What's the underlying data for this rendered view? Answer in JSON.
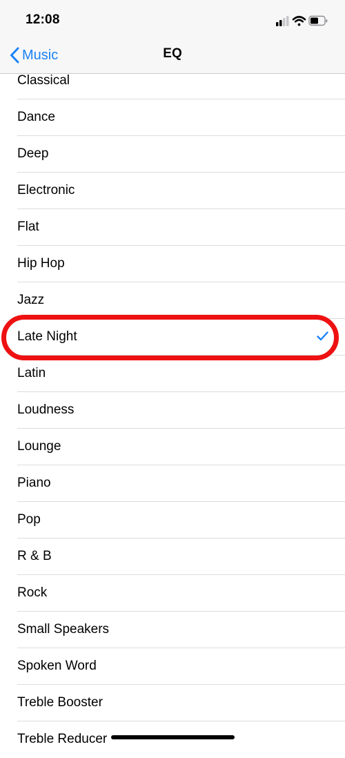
{
  "status_bar": {
    "time": "12:08",
    "icons": [
      "signal-icon",
      "wifi-icon",
      "battery-icon"
    ]
  },
  "nav": {
    "back_label": "Music",
    "back_icon": "chevron-left-icon",
    "title": "EQ"
  },
  "colors": {
    "accent": "#1a82f7",
    "highlight_ring": "#ee1111",
    "separator": "#dcdcdf",
    "bar_background": "#f7f7f7"
  },
  "eq_presets": [
    "Classical",
    "Dance",
    "Deep",
    "Electronic",
    "Flat",
    "Hip Hop",
    "Jazz",
    "Late Night",
    "Latin",
    "Loudness",
    "Lounge",
    "Piano",
    "Pop",
    "R & B",
    "Rock",
    "Small Speakers",
    "Spoken Word",
    "Treble Booster",
    "Treble Reducer"
  ],
  "selected_preset": "Late Night",
  "selected_icon": "checkmark-icon"
}
